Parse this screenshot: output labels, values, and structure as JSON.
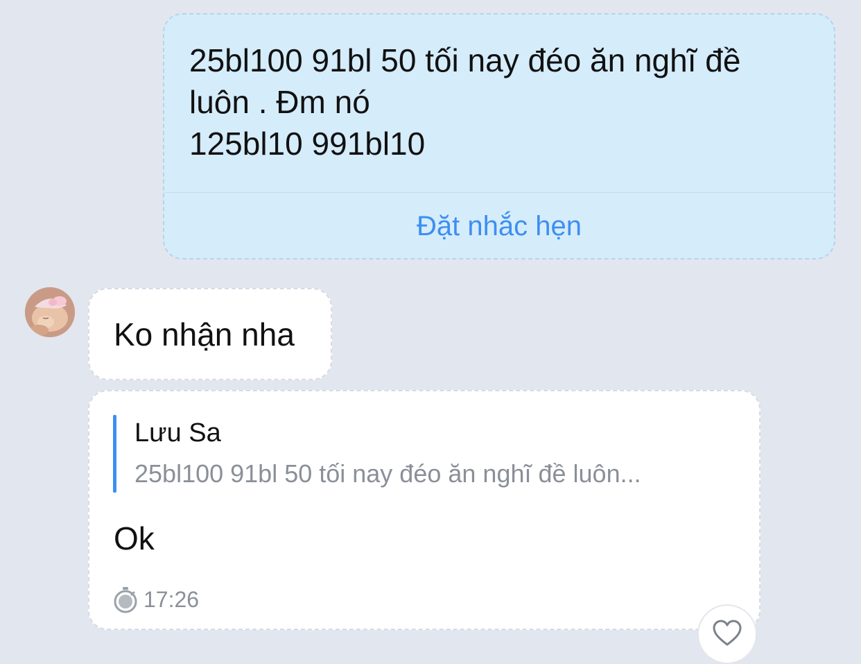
{
  "outgoing_message": {
    "text": "25bl100 91bl 50 tối nay đéo ăn nghĩ đề\nluôn . Đm nó\n125bl10 991bl10",
    "reminder_label": "Đặt nhắc hẹn"
  },
  "incoming_messages": [
    {
      "text": "Ko nhận nha"
    },
    {
      "quote": {
        "author": "Lưu Sa",
        "text": "25bl100 91bl 50 tối nay đéo ăn nghĩ đề luôn..."
      },
      "text": "Ok",
      "time": "17:26"
    }
  ],
  "icons": {
    "clock": "clock-pending-icon",
    "reaction": "heart-icon",
    "avatar": "contact-avatar"
  },
  "colors": {
    "background": "#e2e6ef",
    "outgoing_bubble": "#d5ecfb",
    "incoming_bubble": "#ffffff",
    "accent": "#3d8ef2",
    "muted_text": "#8a8f98"
  }
}
